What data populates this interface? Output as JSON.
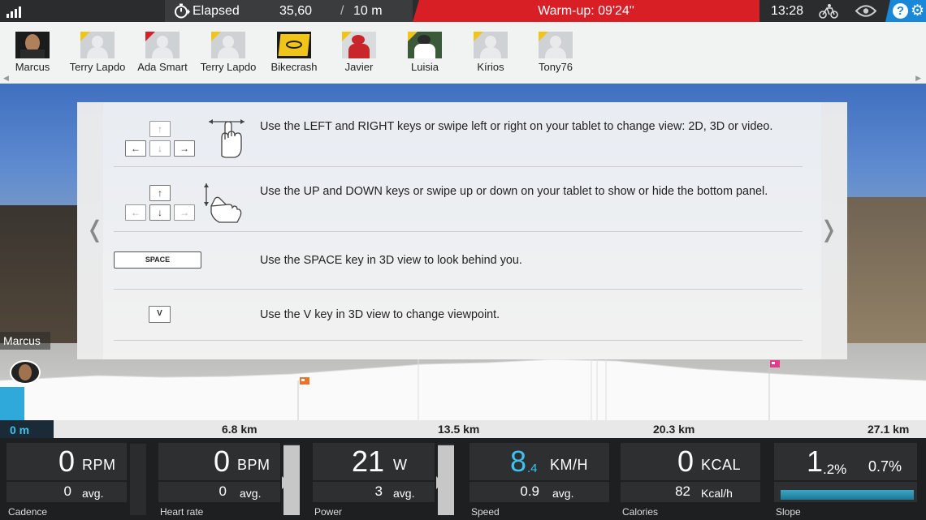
{
  "topbar": {
    "elapsed_label": "Elapsed",
    "distance": "35,60",
    "separator": "/",
    "distance_total": "10 m",
    "warmup": "Warm-up: 09'24''",
    "clock": "13:28",
    "help_glyph": "?",
    "icons": [
      "signal-icon",
      "stopwatch-icon",
      "bike-icon",
      "eye-icon",
      "help-icon",
      "gear-icon"
    ]
  },
  "riders": [
    {
      "name": "Marcus",
      "photo": "dark"
    },
    {
      "name": "Terry Lapdo",
      "photo": "placeholder"
    },
    {
      "name": "Ada Smart",
      "photo": "placeholder"
    },
    {
      "name": "Terry Lapdo",
      "photo": "placeholder"
    },
    {
      "name": "Bikecrash",
      "photo": "sign"
    },
    {
      "name": "Javier",
      "photo": "cyclist"
    },
    {
      "name": "Luisia",
      "photo": "cyclist"
    },
    {
      "name": "Kírios",
      "photo": "placeholder"
    },
    {
      "name": "Tony76",
      "photo": "placeholder"
    }
  ],
  "scene": {
    "rider_label": "Marcus"
  },
  "help": {
    "tip1": "Use the LEFT and RIGHT keys or swipe left or right on your tablet to change view: 2D, 3D or video.",
    "tip2": "Use the UP and DOWN keys or swipe up or down on your tablet to show or hide the bottom panel.",
    "tip3": "Use the SPACE key in 3D view to look behind you.",
    "tip4": "Use the V key in 3D view to change viewpoint.",
    "space_key": "SPACE",
    "v_key": "V",
    "arrow_up": "↑",
    "arrow_down": "↓",
    "arrow_left": "←",
    "arrow_right": "→",
    "prev_glyph": "❬",
    "next_glyph": "❭"
  },
  "distance_bar": {
    "current": "0 m",
    "ticks": [
      "6.8 km",
      "13.5 km",
      "20.3 km",
      "27.1 km"
    ]
  },
  "metrics": {
    "cadence": {
      "value": "0",
      "unit": "RPM",
      "avg": "0",
      "avg_label": "avg.",
      "caption": "Cadence"
    },
    "heart": {
      "value": "0",
      "unit": "BPM",
      "avg": "0",
      "avg_label": "avg.",
      "caption": "Heart rate",
      "gauge_level": 0.98
    },
    "power": {
      "value": "21",
      "unit": "W",
      "avg": "3",
      "avg_label": "avg.",
      "caption": "Power",
      "gauge_level": 0.98
    },
    "speed": {
      "value": "8",
      "decimal": ".4",
      "unit": "KM/H",
      "avg": "0.9",
      "avg_label": "avg.",
      "caption": "Speed"
    },
    "calories": {
      "value": "0",
      "unit": "KCAL",
      "avg": "82",
      "avg_label": "Kcal/h",
      "caption": "Calories"
    },
    "slope": {
      "value": "1",
      "decimal": ".2%",
      "second": "0.7%",
      "caption": "Slope"
    }
  },
  "colors": {
    "warmup": "#d81f26",
    "help": "#1a88d9",
    "speed": "#3cc3f0",
    "slope_bar": "#2a94b4"
  }
}
